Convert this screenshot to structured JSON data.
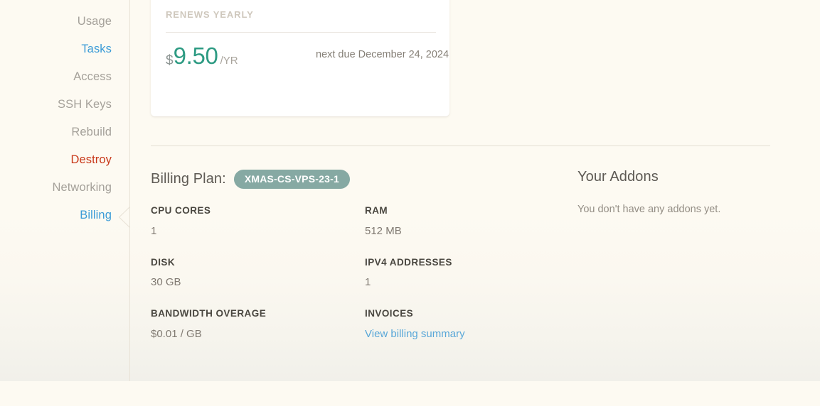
{
  "sidebar": {
    "items": [
      {
        "label": "Usage",
        "state": "default"
      },
      {
        "label": "Tasks",
        "state": "link"
      },
      {
        "label": "Access",
        "state": "default"
      },
      {
        "label": "SSH Keys",
        "state": "default"
      },
      {
        "label": "Rebuild",
        "state": "default"
      },
      {
        "label": "Destroy",
        "state": "danger"
      },
      {
        "label": "Networking",
        "state": "default"
      },
      {
        "label": "Billing",
        "state": "link"
      }
    ],
    "active_item": "Billing"
  },
  "renewal_card": {
    "heading": "RENEWS YEARLY",
    "currency_symbol": "$",
    "amount": "9.50",
    "period": "/YR",
    "next_due": "next due December 24, 2024"
  },
  "billing_plan": {
    "title": "Billing Plan:",
    "plan_badge": "XMAS-CS-VPS-23-1"
  },
  "specs": [
    [
      {
        "label": "CPU CORES",
        "value": "1",
        "kind": "text"
      },
      {
        "label": "RAM",
        "value": "512 MB",
        "kind": "text"
      }
    ],
    [
      {
        "label": "DISK",
        "value": "30 GB",
        "kind": "text"
      },
      {
        "label": "IPV4 ADDRESSES",
        "value": "1",
        "kind": "text"
      }
    ],
    [
      {
        "label": "BANDWIDTH OVERAGE",
        "value": "$0.01 / GB",
        "kind": "text"
      },
      {
        "label": "INVOICES",
        "value": "View billing summary",
        "kind": "link"
      }
    ]
  ],
  "addons": {
    "title": "Your Addons",
    "empty_message": "You don't have any addons yet."
  },
  "colors": {
    "page_background": "#fdfaf2",
    "card_background": "#ffffff",
    "link": "#3c9cd7",
    "danger": "#c8381a",
    "price_accent": "#2e9b83",
    "badge_background": "#86a9a3",
    "muted_text": "#a5a19a",
    "label_text": "#4a4740"
  }
}
